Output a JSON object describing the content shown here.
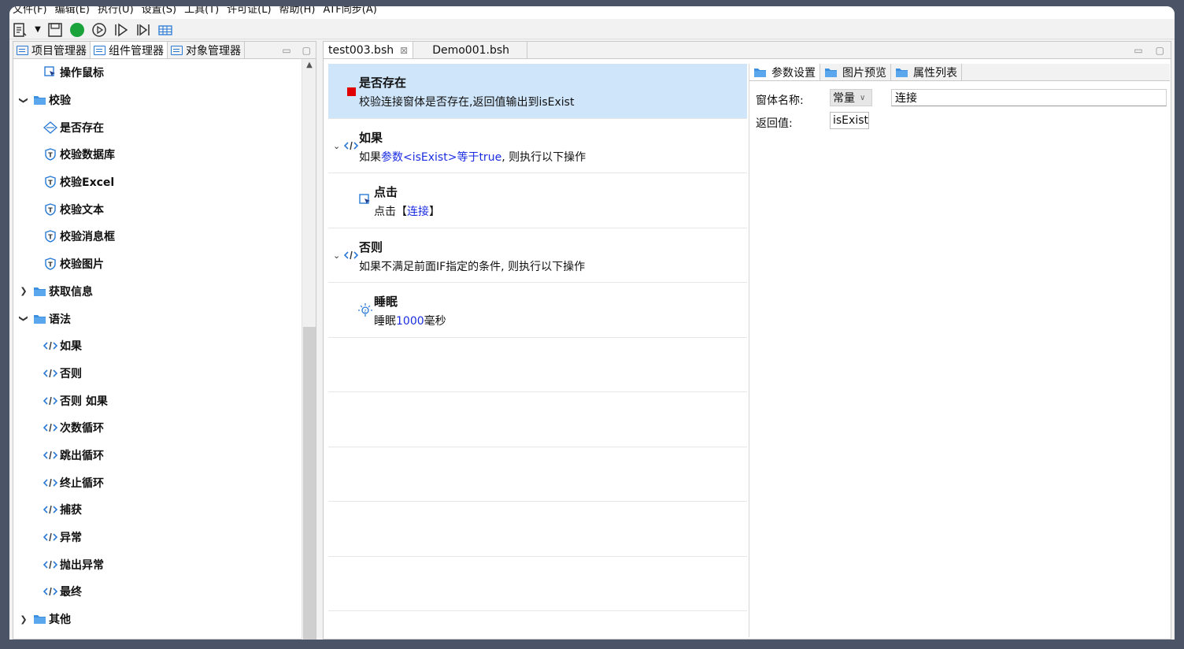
{
  "menu": [
    "文件(F)",
    "编辑(E)",
    "执行(U)",
    "设置(S)",
    "工具(T)",
    "许可证(L)",
    "帮助(H)",
    "ATF同步(A)"
  ],
  "colors": {
    "accent": "#2a7ad5",
    "selected": "#cfe5fa",
    "marker": "#e00000",
    "link": "#1a2ce0",
    "run": "#1aa33a"
  },
  "left_tabs": [
    "项目管理器",
    "组件管理器",
    "对象管理器"
  ],
  "tree": [
    {
      "label": "操作鼠标",
      "level": 2,
      "icon": "mouse-cursor-icon"
    },
    {
      "label": "校验",
      "level": 1,
      "icon": "folder-icon",
      "expanded": true
    },
    {
      "label": "是否存在",
      "level": 2,
      "icon": "diamond-icon"
    },
    {
      "label": "校验数据库",
      "level": 2,
      "icon": "shield-icon"
    },
    {
      "label": "校验Excel",
      "level": 2,
      "icon": "shield-icon"
    },
    {
      "label": "校验文本",
      "level": 2,
      "icon": "shield-icon"
    },
    {
      "label": "校验消息框",
      "level": 2,
      "icon": "shield-icon"
    },
    {
      "label": "校验图片",
      "level": 2,
      "icon": "shield-icon"
    },
    {
      "label": "获取信息",
      "level": 1,
      "icon": "folder-icon",
      "expanded": false
    },
    {
      "label": "语法",
      "level": 1,
      "icon": "folder-icon",
      "expanded": true
    },
    {
      "label": "如果",
      "level": 2,
      "icon": "code-icon"
    },
    {
      "label": "否则",
      "level": 2,
      "icon": "code-icon"
    },
    {
      "label": "否则 如果",
      "level": 2,
      "icon": "code-icon"
    },
    {
      "label": "次数循环",
      "level": 2,
      "icon": "code-icon"
    },
    {
      "label": "跳出循环",
      "level": 2,
      "icon": "code-icon"
    },
    {
      "label": "终止循环",
      "level": 2,
      "icon": "code-icon"
    },
    {
      "label": "捕获",
      "level": 2,
      "icon": "code-icon"
    },
    {
      "label": "异常",
      "level": 2,
      "icon": "code-icon"
    },
    {
      "label": "抛出异常",
      "level": 2,
      "icon": "code-icon"
    },
    {
      "label": "最终",
      "level": 2,
      "icon": "code-icon"
    },
    {
      "label": "其他",
      "level": 1,
      "icon": "folder-icon",
      "expanded": false
    }
  ],
  "editor_tabs": [
    {
      "label": "test003.bsh",
      "active": true,
      "closable": true
    },
    {
      "label": "Demo001.bsh",
      "active": false,
      "closable": false
    }
  ],
  "steps": [
    {
      "title": "是否存在",
      "icon": "marker",
      "selected": true,
      "desc": [
        {
          "t": "校验连接窗体是否存在,返回值输出到isExist",
          "b": false
        }
      ]
    },
    {
      "title": "如果",
      "icon": "code-icon",
      "collapsible": true,
      "desc": [
        {
          "t": "如果",
          "b": false
        },
        {
          "t": "参数<isExist>等于true",
          "b": true
        },
        {
          "t": ", 则执行以下操作",
          "b": false
        }
      ]
    },
    {
      "title": "点击",
      "icon": "mouse-cursor-icon",
      "indent": true,
      "desc": [
        {
          "t": "点击【",
          "b": false
        },
        {
          "t": "连接",
          "b": true
        },
        {
          "t": "】",
          "b": false
        }
      ]
    },
    {
      "title": "否则",
      "icon": "code-icon",
      "collapsible": true,
      "desc": [
        {
          "t": "如果不满足前面IF指定的条件, 则执行以下操作",
          "b": false
        }
      ]
    },
    {
      "title": "睡眠",
      "icon": "sleep-icon",
      "indent": true,
      "desc": [
        {
          "t": "睡眠",
          "b": false
        },
        {
          "t": "1000",
          "b": true
        },
        {
          "t": "毫秒",
          "b": false
        }
      ]
    }
  ],
  "empty_rows": 5,
  "prop_tabs": [
    "参数设置",
    "图片预览",
    "属性列表"
  ],
  "props": {
    "window_name_label": "窗体名称:",
    "window_type": "常量",
    "window_value": "连接",
    "return_label": "返回值:",
    "return_value": "isExist"
  }
}
